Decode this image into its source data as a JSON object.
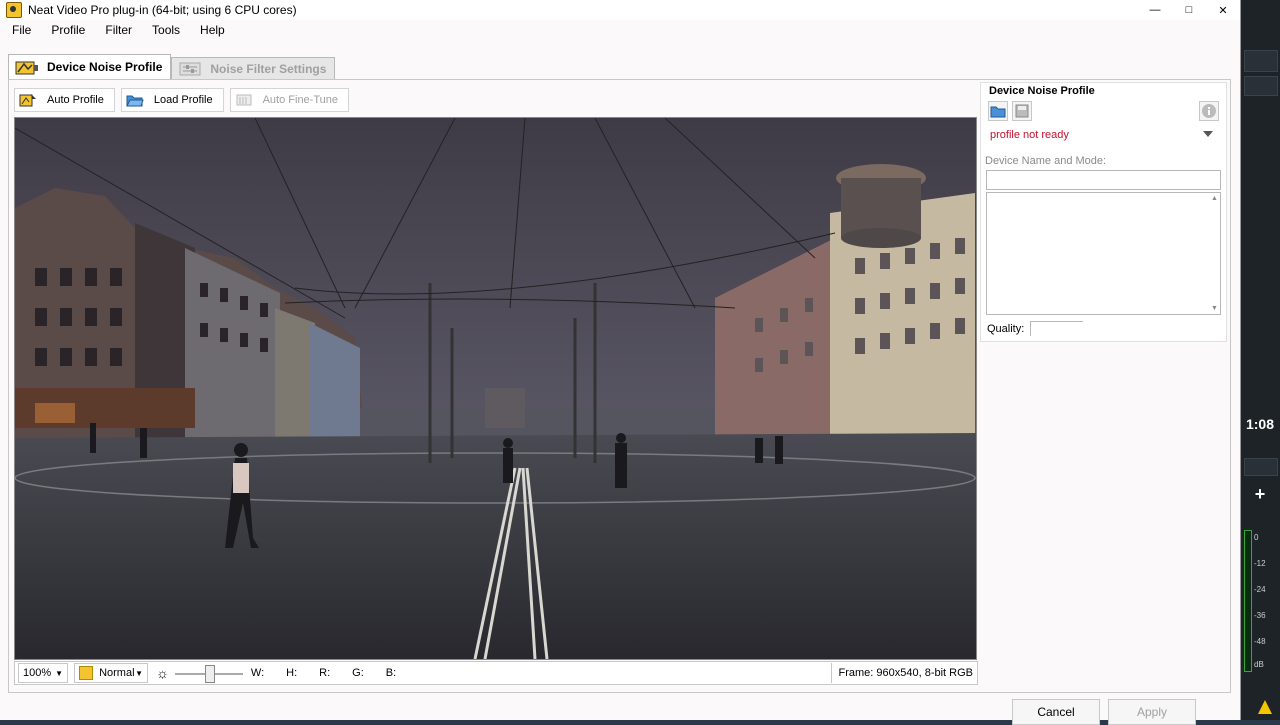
{
  "window": {
    "title": "Neat Video Pro plug-in (64-bit; using 6 CPU cores)"
  },
  "menu": [
    "File",
    "Profile",
    "Filter",
    "Tools",
    "Help"
  ],
  "tabs": [
    {
      "label": "Device Noise Profile",
      "active": true
    },
    {
      "label": "Noise Filter Settings",
      "active": false
    }
  ],
  "toolbar": {
    "auto_profile": "Auto Profile",
    "load_profile": "Load Profile",
    "auto_fine_tune": "Auto Fine-Tune"
  },
  "status": {
    "zoom": "100%",
    "mode": "Normal",
    "w_label": "W:",
    "h_label": "H:",
    "r_label": "R:",
    "g_label": "G:",
    "b_label": "B:",
    "frame_info": "Frame: 960x540, 8-bit RGB"
  },
  "side_panel": {
    "title": "Device Noise Profile",
    "profile_status": "profile not ready",
    "device_label": "Device Name and Mode:",
    "device_value": "",
    "notes": "",
    "quality_label": "Quality:"
  },
  "dialog_buttons": {
    "cancel": "Cancel",
    "apply": "Apply"
  },
  "host_app": {
    "timecode": "1:08",
    "meter_scale": [
      "0",
      "-12",
      "-24",
      "-36",
      "-48",
      "dB"
    ]
  },
  "colors": {
    "status_error": "#c8102e",
    "accent_icon": "#f4c430"
  }
}
